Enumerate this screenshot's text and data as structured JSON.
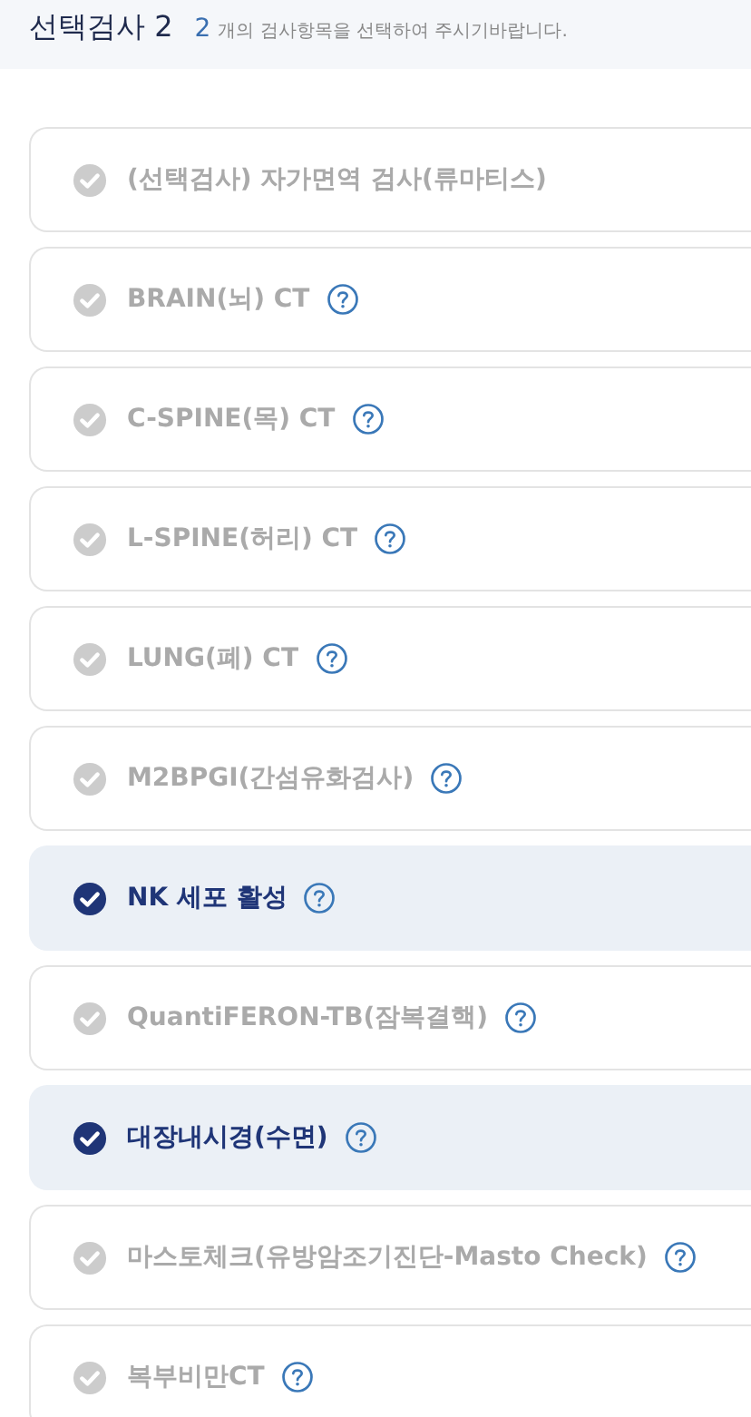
{
  "header": {
    "title": "선택검사 2",
    "count": "2",
    "hint": "개의 검사항목을 선택하여 주시기바랍니다."
  },
  "items": [
    {
      "label": "(선택검사) 자가면역 검사(류마티스)",
      "selected": false,
      "help": false
    },
    {
      "label": "BRAIN(뇌) CT",
      "selected": false,
      "help": true
    },
    {
      "label": "C-SPINE(목) CT",
      "selected": false,
      "help": true
    },
    {
      "label": "L-SPINE(허리) CT",
      "selected": false,
      "help": true
    },
    {
      "label": "LUNG(폐) CT",
      "selected": false,
      "help": true
    },
    {
      "label": "M2BPGI(간섬유화검사)",
      "selected": false,
      "help": true
    },
    {
      "label": "NK 세포 활성",
      "selected": true,
      "help": true
    },
    {
      "label": "QuantiFERON-TB(잠복결핵)",
      "selected": false,
      "help": true
    },
    {
      "label": "대장내시경(수면)",
      "selected": true,
      "help": true
    },
    {
      "label": "마스토체크(유방암조기진단-Masto Check)",
      "selected": false,
      "help": true
    },
    {
      "label": "복부비만CT",
      "selected": false,
      "help": true
    }
  ]
}
